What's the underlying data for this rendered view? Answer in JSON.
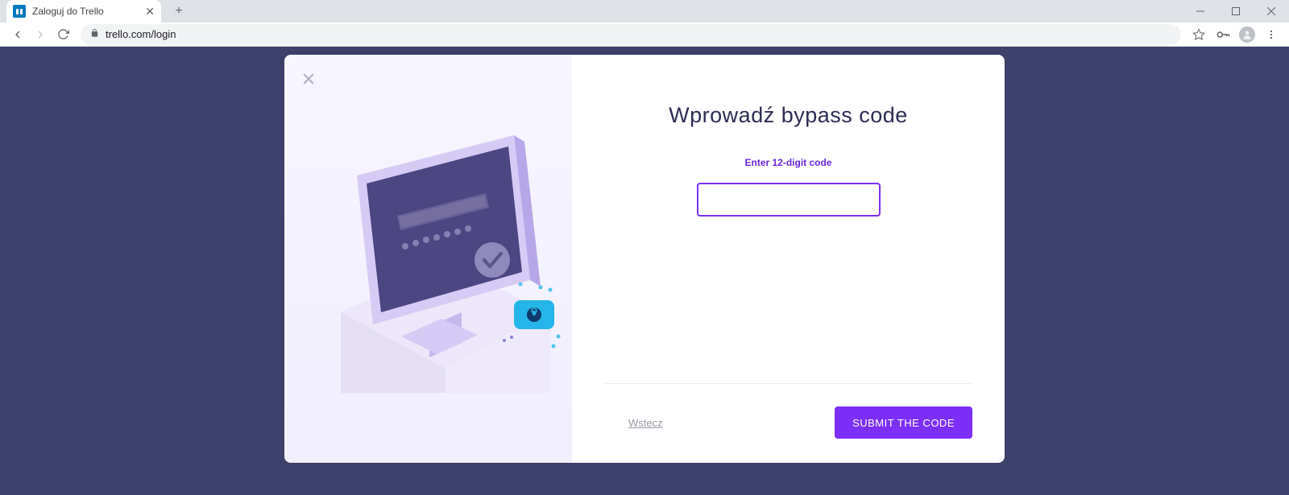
{
  "browser": {
    "tab_title": "Zaloguj do Trello",
    "url": "trello.com/login"
  },
  "modal": {
    "heading": "Wprowadź bypass code",
    "prompt": "Enter 12-digit code",
    "code_value": "",
    "back_label": "Wstecz",
    "submit_label": "SUBMIT THE CODE"
  },
  "icons": {
    "close": "close-icon",
    "lock": "lock-icon",
    "star": "star-icon",
    "key": "key-icon",
    "profile": "profile-icon",
    "menu": "menu-icon"
  },
  "colors": {
    "page_bg": "#3d4068",
    "accent": "#7b2ff7",
    "heading": "#2c2c54"
  }
}
